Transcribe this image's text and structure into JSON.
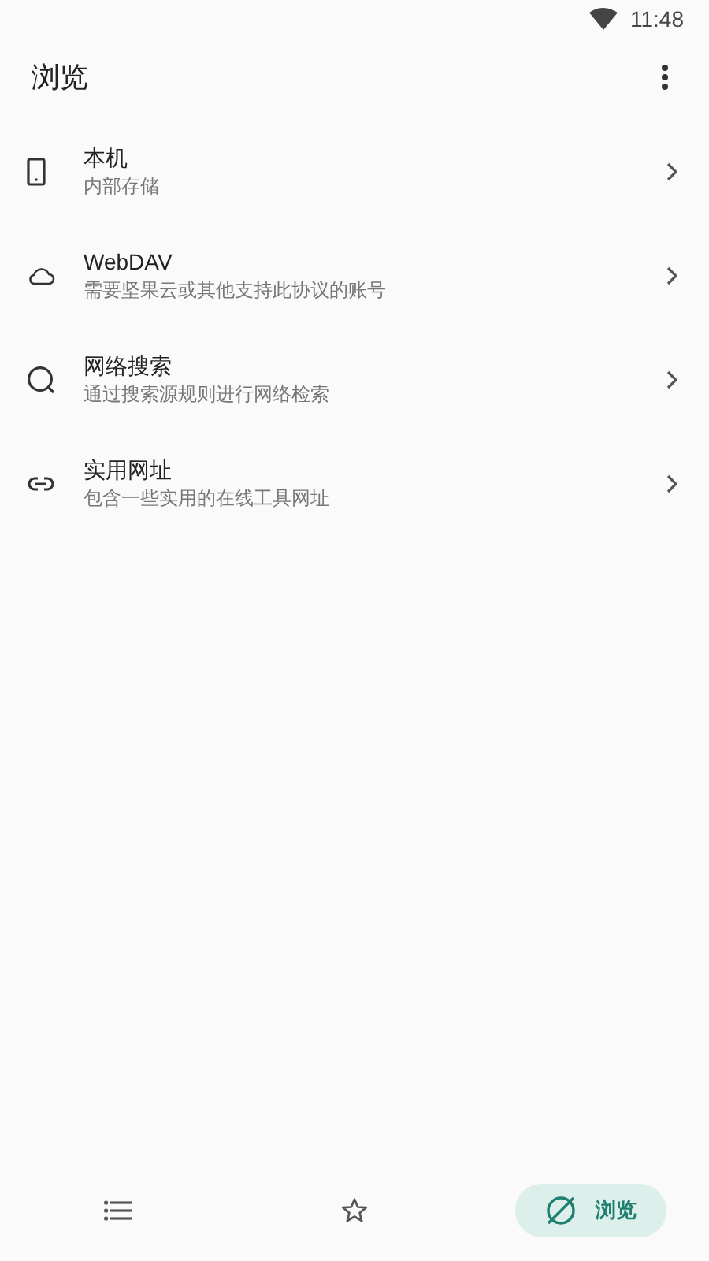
{
  "status_bar": {
    "time": "11:48"
  },
  "app_bar": {
    "title": "浏览"
  },
  "items": [
    {
      "kind": "phone",
      "title": "本机",
      "subtitle": "内部存储"
    },
    {
      "kind": "cloud",
      "title": "WebDAV",
      "subtitle": "需要坚果云或其他支持此协议的账号"
    },
    {
      "kind": "search",
      "title": "网络搜索",
      "subtitle": "通过搜索源规则进行网络检索"
    },
    {
      "kind": "link",
      "title": "实用网址",
      "subtitle": "包含一些实用的在线工具网址"
    }
  ],
  "bottom_nav": [
    {
      "kind": "list",
      "selected": false
    },
    {
      "kind": "star",
      "selected": false
    },
    {
      "kind": "browse",
      "selected": true,
      "label": "浏览"
    }
  ]
}
